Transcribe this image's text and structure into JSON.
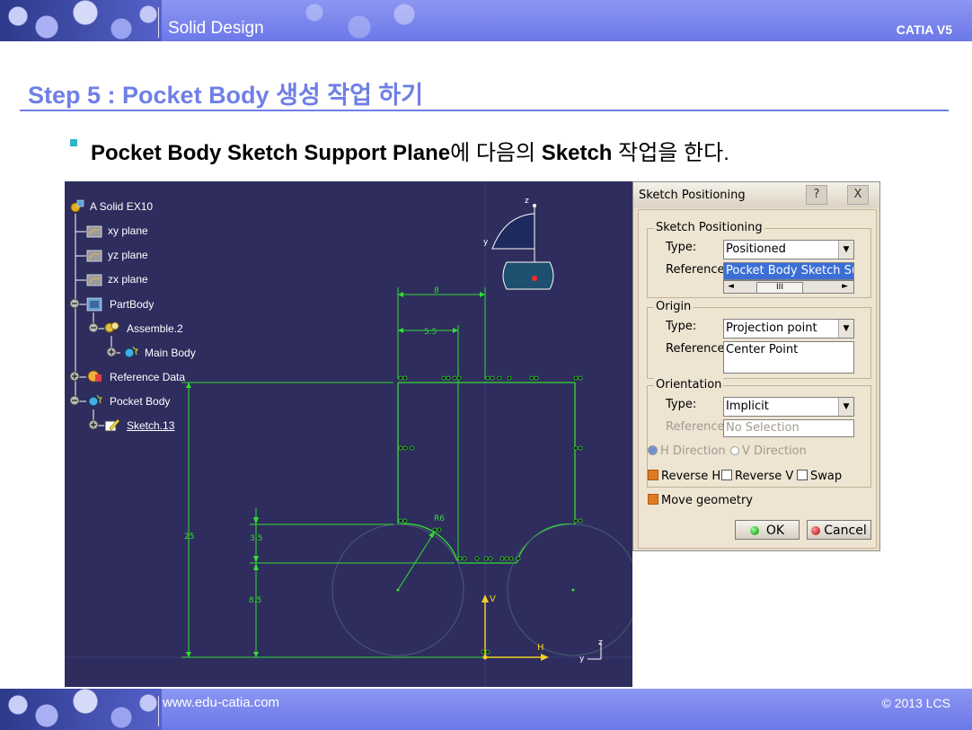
{
  "header": {
    "section": "Solid Design",
    "product": "CATIA V5"
  },
  "title": "Step 5 : Pocket Body 생성 작업 하기",
  "bullet": {
    "bold1": "Pocket Body Sketch Support Plane",
    "mid": "에 다음의 ",
    "bold2": "Sketch",
    "end": " 작업을 한다."
  },
  "tree": {
    "root": "A Solid EX10",
    "xy": "xy plane",
    "yz": "yz plane",
    "zx": "zx plane",
    "partbody": "PartBody",
    "assemble": "Assemble.2",
    "mainbody": "Main Body",
    "refdata": "Reference Data",
    "pocketbody": "Pocket Body",
    "sketch": "Sketch.13"
  },
  "sketch_labels": {
    "d8": "8",
    "d55": "5.5",
    "d25": "25",
    "d35": "3.5",
    "d85": "8.5",
    "r6": "R6",
    "axis_h": "H",
    "axis_v": "V",
    "axis_z": "z",
    "axis_y": "y"
  },
  "dialog": {
    "title": "Sketch Positioning",
    "help": "?",
    "close": "X",
    "group1": "Sketch Positioning",
    "type_label": "Type:",
    "reference_label": "Reference:",
    "g1_type": "Positioned",
    "g1_reference": "Pocket Body Sketch Su",
    "scroll_thumb": "III",
    "group2": "Origin",
    "g2_type": "Projection point",
    "g2_reference": "Center Point",
    "group3": "Orientation",
    "g3_type": "Implicit",
    "g3_reference": "No Selection",
    "h_direction": "H Direction",
    "v_direction": "V Direction",
    "reverse_h": "Reverse H",
    "reverse_v": "Reverse V",
    "swap": "Swap",
    "move_geometry": "Move geometry",
    "ok": "OK",
    "cancel": "Cancel"
  },
  "footer": {
    "url": "www.edu-catia.com",
    "copyright": "© 2013 LCS"
  },
  "colors": {
    "accent": "#6f7fe6",
    "viewport": "#2e2d5e",
    "sketch_line": "#33dd33",
    "dialog_bg": "#e8dcc8"
  }
}
